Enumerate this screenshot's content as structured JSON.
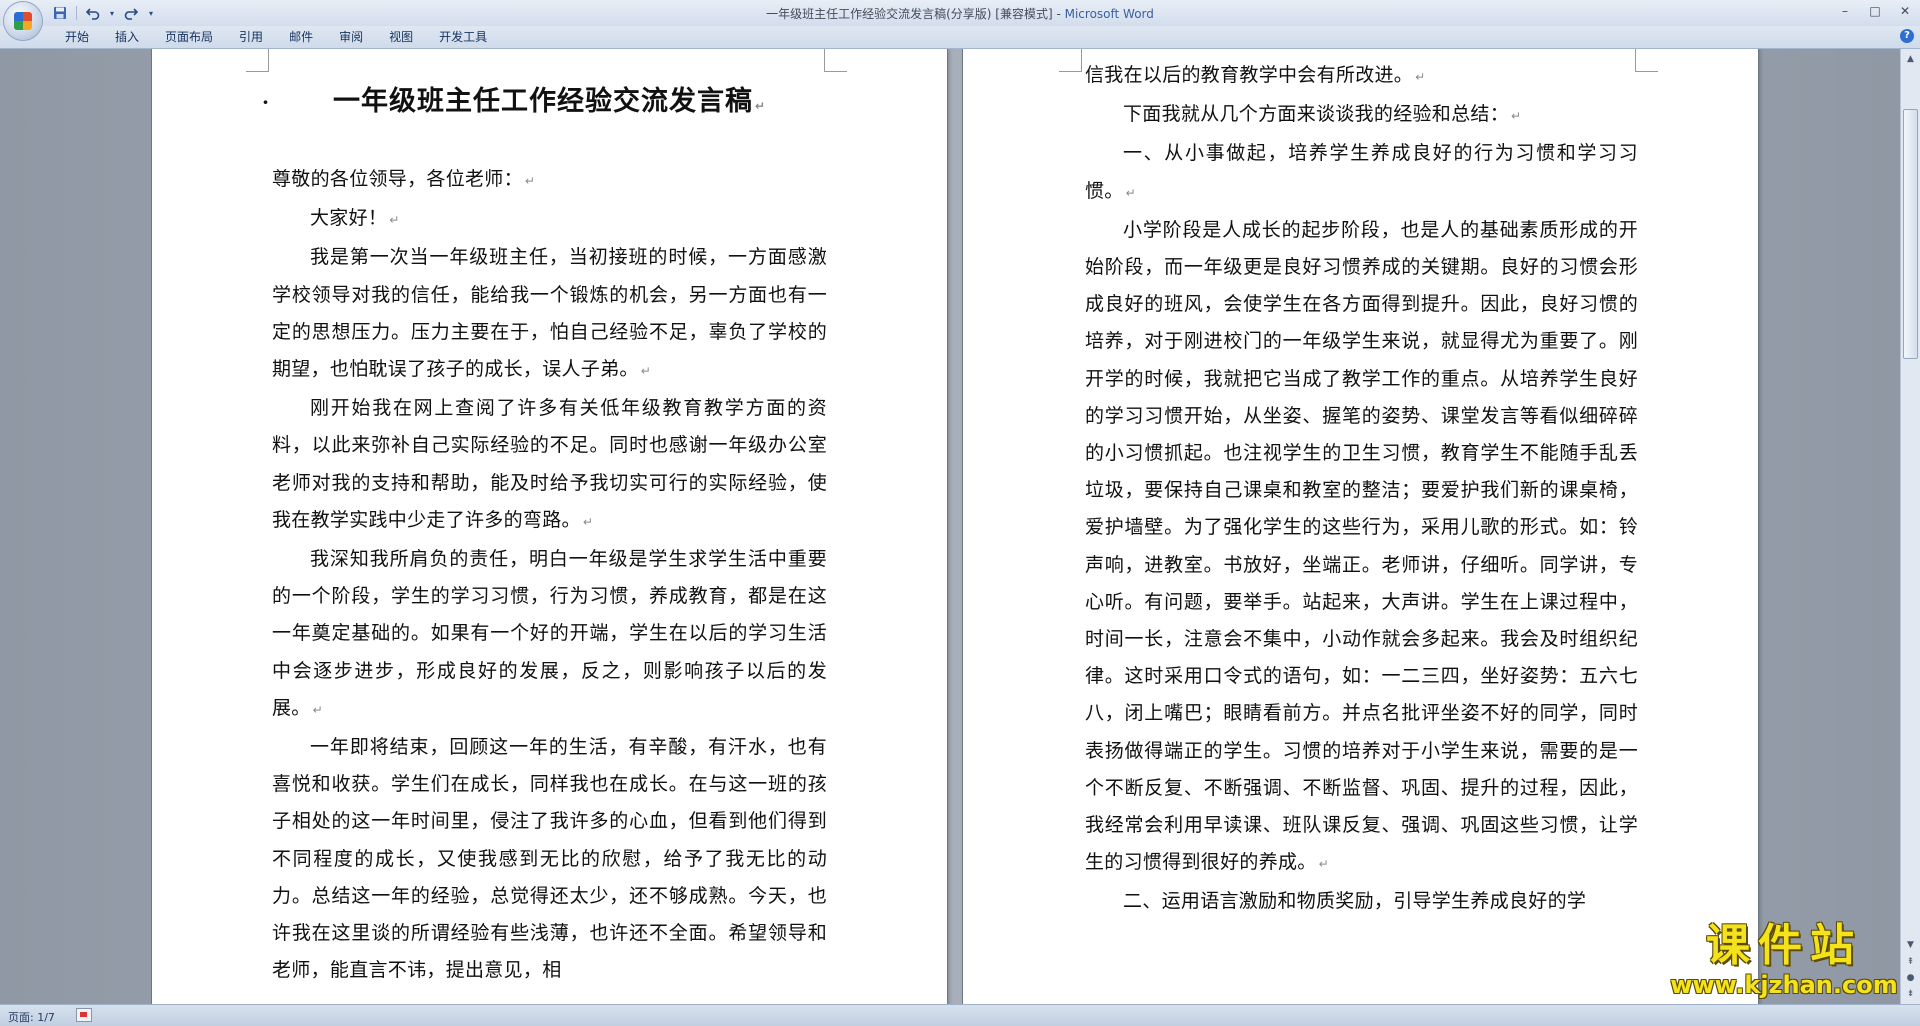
{
  "window": {
    "title": "一年级班主任工作经验交流发言稿(分享版) [兼容模式]",
    "title_separator": " - ",
    "app_name": "Microsoft Word",
    "controls": [
      "–",
      "□",
      "✕"
    ]
  },
  "quick_access": {
    "save_icon": "save-icon",
    "undo_icon": "undo-icon",
    "redo_icon": "redo-icon",
    "customize_icon": "chevron-down-icon"
  },
  "ribbon": {
    "tabs": [
      "开始",
      "插入",
      "页面布局",
      "引用",
      "邮件",
      "审阅",
      "视图",
      "开发工具"
    ],
    "help": "?"
  },
  "page_left": {
    "title": "一年级班主任工作经验交流发言稿",
    "title_bullet": "·",
    "paragraphs": [
      "尊敬的各位领导，各位老师：",
      "大家好！",
      "我是第一次当一年级班主任，当初接班的时候，一方面感激学校领导对我的信任，能给我一个锻炼的机会，另一方面也有一定的思想压力。压力主要在于，怕自己经验不足，辜负了学校的期望，也怕耽误了孩子的成长，误人子弟。",
      "刚开始我在网上查阅了许多有关低年级教育教学方面的资料，以此来弥补自己实际经验的不足。同时也感谢一年级办公室老师对我的支持和帮助，能及时给予我切实可行的实际经验，使我在教学实践中少走了许多的弯路。",
      "我深知我所肩负的责任，明白一年级是学生求学生活中重要的一个阶段，学生的学习习惯，行为习惯，养成教育，都是在这一年奠定基础的。如果有一个好的开端，学生在以后的学习生活中会逐步进步，形成良好的发展，反之，则影响孩子以后的发展。",
      "一年即将结束，回顾这一年的生活，有辛酸，有汗水，也有喜悦和收获。学生们在成长，同样我也在成长。在与这一班的孩子相处的这一年时间里，侵注了我许多的心血，但看到他们得到不同程度的成长，又使我感到无比的欣慰，给予了我无比的动力。总结这一年的经验，总觉得还太少，还不够成熟。今天，也许我在这里谈的所谓经验有些浅薄，也许还不全面。希望领导和老师，能直言不讳，提出意见，相"
    ]
  },
  "page_right": {
    "paragraphs": [
      "信我在以后的教育教学中会有所改进。",
      "下面我就从几个方面来谈谈我的经验和总结：",
      "一、从小事做起，培养学生养成良好的行为习惯和学习习惯。",
      "小学阶段是人成长的起步阶段，也是人的基础素质形成的开始阶段，而一年级更是良好习惯养成的关键期。良好的习惯会形成良好的班风，会使学生在各方面得到提升。因此，良好习惯的培养，对于刚进校门的一年级学生来说，就显得尤为重要了。刚开学的时候，我就把它当成了教学工作的重点。从培养学生良好的学习习惯开始，从坐姿、握笔的姿势、课堂发言等看似细碎碎的小习惯抓起。也注视学生的卫生习惯，教育学生不能随手乱丢垃圾，要保持自己课桌和教室的整洁；要爱护我们新的课桌椅，爱护墙壁。为了强化学生的这些行为，采用儿歌的形式。如：铃声响，进教室。书放好，坐端正。老师讲，仔细听。同学讲，专心听。有问题，要举手。站起来，大声讲。学生在上课过程中，时间一长，注意会不集中，小动作就会多起来。我会及时组织纪律。这时采用口令式的语句，如：一二三四，坐好姿势：五六七八，闭上嘴巴；眼睛看前方。并点名批评坐姿不好的同学，同时表扬做得端正的学生。习惯的培养对于小学生来说，需要的是一个不断反复、不断强调、不断监督、巩固、提升的过程，因此，我经常会利用早读课、班队课反复、强调、巩固这些习惯，让学生的习惯得到很好的养成。",
      "二、运用语言激励和物质奖励，引导学生养成良好的学"
    ]
  },
  "paragraph_mark": "↵",
  "statusbar": {
    "page_info": "页面: 1/7"
  },
  "watermark": {
    "text": "课件站",
    "url": "www.kjzhan.com"
  },
  "scrollbar": {
    "up_arrow": "▲",
    "down_arrow": "▼",
    "prev_page": "⇞",
    "select_browse": "●",
    "next_page": "⇟"
  },
  "colors": {
    "ribbon_tab_text": "#15325e",
    "app_name": "#3b5fa3",
    "watermark": "#f4e21b"
  }
}
